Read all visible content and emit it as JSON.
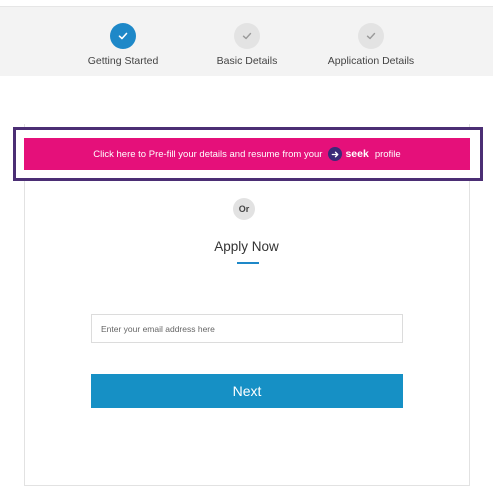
{
  "stepper": {
    "steps": [
      {
        "label": "Getting Started",
        "state": "active",
        "icon": "check-icon"
      },
      {
        "label": "Basic Details",
        "state": "inactive",
        "icon": "check-icon"
      },
      {
        "label": "Application Details",
        "state": "inactive",
        "icon": "check-icon"
      }
    ]
  },
  "prefill": {
    "text_before": "Click here to Pre-fill your details and resume from your",
    "logo_text": "seek",
    "text_after": "profile",
    "color": "#e5107a",
    "highlight_color": "#4b2e74"
  },
  "divider": {
    "label": "Or"
  },
  "apply": {
    "title": "Apply Now"
  },
  "email": {
    "placeholder": "Enter your email address here",
    "value": ""
  },
  "next": {
    "label": "Next"
  },
  "colors": {
    "accent": "#1e88c8",
    "button": "#1690c5"
  }
}
